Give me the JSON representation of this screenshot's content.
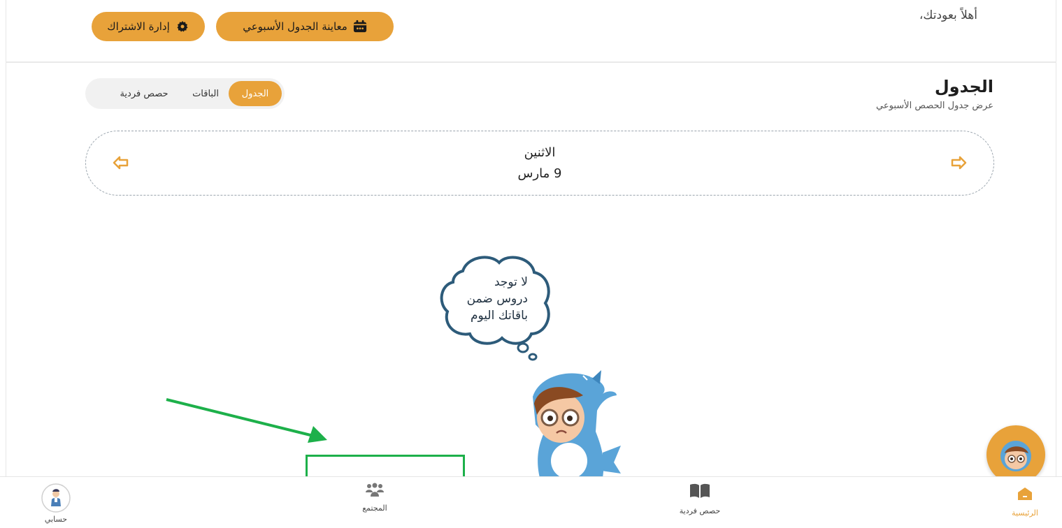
{
  "header": {
    "greeting": "أهلاً بعودتك،",
    "weekly_schedule_button": "معاينة الجدول الأسبوعي",
    "manage_subscription_button": "إدارة الاشتراك"
  },
  "section": {
    "title": "الجدول",
    "subtitle": "عرض جدول الحصص الأسبوعي"
  },
  "tabs": [
    {
      "label": "الجدول",
      "active": true
    },
    {
      "label": "الباقات",
      "active": false
    },
    {
      "label": "حصص فردية",
      "active": false
    }
  ],
  "date_nav": {
    "day": "الاثنين",
    "date": "9 مارس"
  },
  "empty_state": {
    "line1": "لا توجد",
    "line2": "دروس ضمن",
    "line3": "باقاتك اليوم"
  },
  "bottom_nav": {
    "home": "الرئيسية",
    "individual_lessons": "حصص فردية",
    "community": "المجتمع",
    "account": "حسابي"
  },
  "colors": {
    "accent": "#e8a23a",
    "annotation_green": "#1db04a",
    "cloud_stroke": "#2d5b7a"
  }
}
